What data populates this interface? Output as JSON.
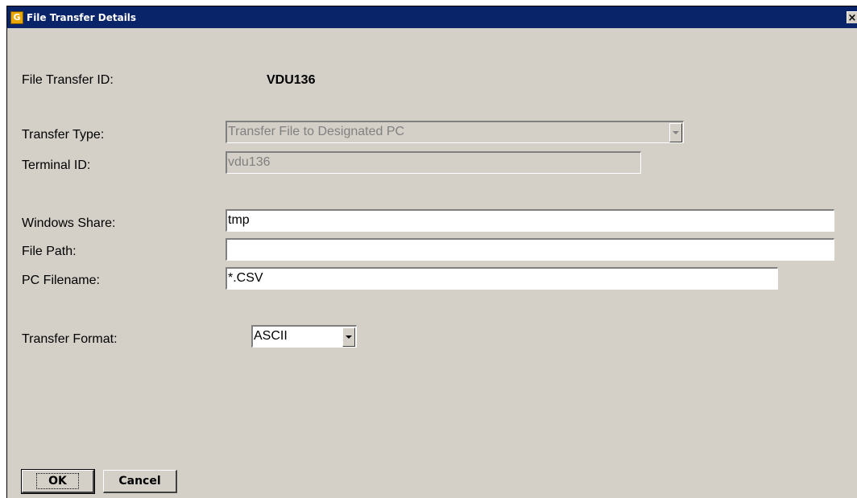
{
  "window": {
    "title": "File Transfer Details",
    "icon_letter": "G",
    "icon_name": "app-g-icon",
    "close_label": "×"
  },
  "form": {
    "file_transfer_id": {
      "label": "File Transfer ID:",
      "value": "VDU136"
    },
    "transfer_type": {
      "label": "Transfer Type:",
      "value": "Transfer File to Designated PC"
    },
    "terminal_id": {
      "label": "Terminal ID:",
      "value": "vdu136"
    },
    "windows_share": {
      "label": "Windows Share:",
      "value": "tmp"
    },
    "file_path": {
      "label": "File Path:",
      "value": ""
    },
    "pc_filename": {
      "label": "PC Filename:",
      "value": "*.CSV"
    },
    "transfer_format": {
      "label": "Transfer Format:",
      "value": "ASCII"
    }
  },
  "buttons": {
    "ok": "OK",
    "cancel": "Cancel"
  },
  "colors": {
    "titlebar": "#0a246a",
    "window_bg": "#d4d0c8",
    "disabled_text": "#808080"
  }
}
